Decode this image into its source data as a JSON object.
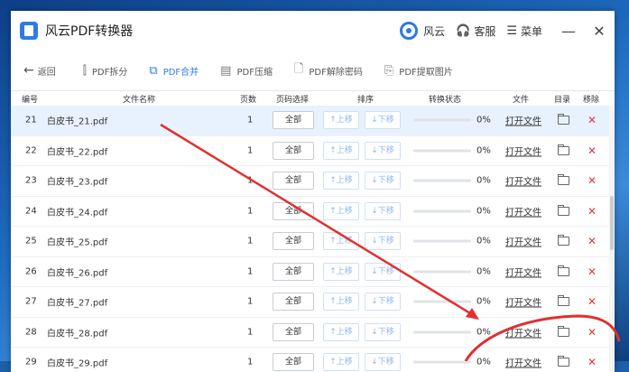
{
  "titlebar": {
    "app_title": "风云PDF转换器",
    "brand_label": "风云",
    "service_label": "客服",
    "menu_label": "菜单",
    "minimize": "—",
    "close": "✕"
  },
  "toolbar": {
    "back_label": "返回",
    "tools": [
      {
        "label": "PDF拆分",
        "icon": "split-icon",
        "active": false
      },
      {
        "label": "PDF合并",
        "icon": "merge-icon",
        "active": true
      },
      {
        "label": "PDF压缩",
        "icon": "compress-icon",
        "active": false
      },
      {
        "label": "PDF解除密码",
        "icon": "unlock-icon",
        "active": false
      },
      {
        "label": "PDF提取图片",
        "icon": "image-extract-icon",
        "active": false
      }
    ]
  },
  "table": {
    "headers": {
      "num": "编号",
      "name": "文件名称",
      "pages": "页数",
      "range": "页码选择",
      "order": "排序",
      "status": "转换状态",
      "file": "文件",
      "dir": "目录",
      "remove": "移除"
    },
    "rows": [
      {
        "num": "21",
        "name": "白皮书_21.pdf",
        "pages": "1",
        "range": "全部",
        "up": "↑上移",
        "down": "↓下移",
        "progress": 0,
        "pct": "0%",
        "open": "打开文件",
        "selected": true
      },
      {
        "num": "22",
        "name": "白皮书_22.pdf",
        "pages": "1",
        "range": "全部",
        "up": "↑上移",
        "down": "↓下移",
        "progress": 0,
        "pct": "0%",
        "open": "打开文件",
        "selected": false
      },
      {
        "num": "23",
        "name": "白皮书_23.pdf",
        "pages": "1",
        "range": "全部",
        "up": "↑上移",
        "down": "↓下移",
        "progress": 0,
        "pct": "0%",
        "open": "打开文件",
        "selected": false
      },
      {
        "num": "24",
        "name": "白皮书_24.pdf",
        "pages": "1",
        "range": "全部",
        "up": "↑上移",
        "down": "↓下移",
        "progress": 0,
        "pct": "0%",
        "open": "打开文件",
        "selected": false
      },
      {
        "num": "25",
        "name": "白皮书_25.pdf",
        "pages": "1",
        "range": "全部",
        "up": "↑上移",
        "down": "↓下移",
        "progress": 0,
        "pct": "0%",
        "open": "打开文件",
        "selected": false
      },
      {
        "num": "26",
        "name": "白皮书_26.pdf",
        "pages": "1",
        "range": "全部",
        "up": "↑上移",
        "down": "↓下移",
        "progress": 0,
        "pct": "0%",
        "open": "打开文件",
        "selected": false
      },
      {
        "num": "27",
        "name": "白皮书_27.pdf",
        "pages": "1",
        "range": "全部",
        "up": "↑上移",
        "down": "↓下移",
        "progress": 0,
        "pct": "0%",
        "open": "打开文件",
        "selected": false
      },
      {
        "num": "28",
        "name": "白皮书_28.pdf",
        "pages": "1",
        "range": "全部",
        "up": "↑上移",
        "down": "↓下移",
        "progress": 0,
        "pct": "0%",
        "open": "打开文件",
        "selected": false
      },
      {
        "num": "29",
        "name": "白皮书_29.pdf",
        "pages": "1",
        "range": "全部",
        "up": "↑上移",
        "down": "↓下移",
        "progress": 0,
        "pct": "0%",
        "open": "打开文件",
        "selected": false
      }
    ]
  },
  "colors": {
    "accent": "#2e7be6",
    "annotation": "#e0312f",
    "delete": "#e0383e"
  }
}
